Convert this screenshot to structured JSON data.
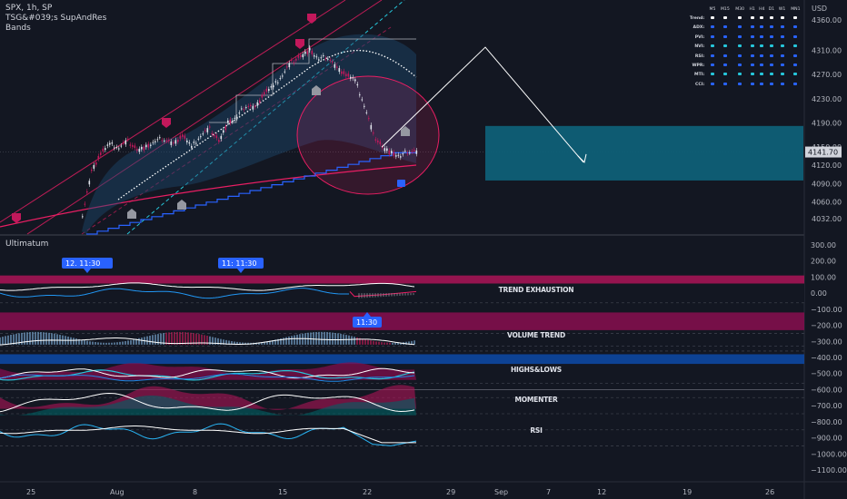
{
  "header": {
    "symbol_line": "SPX, 1h, SP",
    "indicator_line": "TSG&#039;s SupAndRes",
    "indicator_line2": "Bands"
  },
  "indicator_pane": {
    "title": "Ultimatum"
  },
  "price_scale": {
    "currency": "USD",
    "current_price": "4141.70"
  },
  "section_labels": [
    "TREND EXHAUSTION",
    "VOLUME TREND",
    "HIGHS&LOWS",
    "MOMENTER",
    "RSI"
  ],
  "table": {
    "columns": [
      "M5",
      "M15",
      "M30",
      "H1",
      "H4",
      "D1",
      "W1",
      "MN1"
    ],
    "rows": [
      {
        "label": "Trend:",
        "colors": [
          "#ffffff",
          "#ffffff",
          "#ffffff",
          "#ffffff",
          "#ffffff",
          "#ffffff",
          "#ffffff",
          "#ffffff"
        ]
      },
      {
        "label": "ADX:",
        "colors": [
          "#2962ff",
          "#2962ff",
          "#2962ff",
          "#2962ff",
          "#2962ff",
          "#2962ff",
          "#2962ff",
          "#2962ff"
        ]
      },
      {
        "label": "PVI:",
        "colors": [
          "#2962ff",
          "#2962ff",
          "#2962ff",
          "#2962ff",
          "#2962ff",
          "#2962ff",
          "#2962ff",
          "#2962ff"
        ]
      },
      {
        "label": "NVI:",
        "colors": [
          "#26c6da",
          "#26c6da",
          "#26c6da",
          "#26c6da",
          "#26c6da",
          "#26c6da",
          "#26c6da",
          "#26c6da"
        ]
      },
      {
        "label": "RSI:",
        "colors": [
          "#2962ff",
          "#2962ff",
          "#2962ff",
          "#2962ff",
          "#2962ff",
          "#2962ff",
          "#2962ff",
          "#2962ff"
        ]
      },
      {
        "label": "WPR:",
        "colors": [
          "#2962ff",
          "#2962ff",
          "#2962ff",
          "#2962ff",
          "#2962ff",
          "#2962ff",
          "#2962ff",
          "#2962ff"
        ]
      },
      {
        "label": "MTI:",
        "colors": [
          "#26c6da",
          "#26c6da",
          "#26c6da",
          "#26c6da",
          "#26c6da",
          "#26c6da",
          "#26c6da",
          "#26c6da"
        ]
      },
      {
        "label": "CCI:",
        "colors": [
          "#2962ff",
          "#2962ff",
          "#2962ff",
          "#2962ff",
          "#2962ff",
          "#2962ff",
          "#2962ff",
          "#2962ff"
        ]
      }
    ]
  },
  "chart_data": [
    {
      "type": "line",
      "ylim": [
        4010,
        4380
      ],
      "y_ticks": [
        4360,
        4310,
        4270,
        4230,
        4190,
        4150,
        4120,
        4090,
        4060,
        4032
      ],
      "y_tick_labels": [
        "4360.00",
        "4310.00",
        "4270.00",
        "4230.00",
        "4190.00",
        "4150.00",
        "4120.00",
        "4090.00",
        "4060.00",
        "4032.00"
      ],
      "x_tick_labels": [
        "25",
        "Aug",
        "8",
        "15",
        "22",
        "29",
        "Sep",
        "7",
        "12",
        "19",
        "26"
      ],
      "price_path": {
        "x": [
          90,
          100,
          110,
          120,
          130,
          140,
          150,
          160,
          170,
          180,
          190,
          200,
          210,
          220,
          230,
          240,
          250,
          260,
          270,
          280,
          290,
          300,
          310,
          320,
          330,
          340,
          350,
          360,
          370,
          380,
          390,
          400,
          410,
          420,
          430,
          440,
          450,
          458
        ],
        "y": [
          4040,
          4110,
          4140,
          4155,
          4150,
          4160,
          4145,
          4150,
          4160,
          4165,
          4155,
          4170,
          4150,
          4170,
          4180,
          4160,
          4190,
          4200,
          4220,
          4215,
          4240,
          4250,
          4270,
          4290,
          4300,
          4310,
          4295,
          4300,
          4280,
          4270,
          4260,
          4220,
          4170,
          4150,
          4140,
          4135,
          4145,
          4142
        ]
      },
      "target_box": {
        "y_top": 4185,
        "y_bottom": 4095
      },
      "projection": {
        "y": [
          4150,
          4315,
          4125
        ]
      }
    },
    {
      "type": "line",
      "ylim": [
        -1150,
        340
      ],
      "y_ticks": [
        300,
        200,
        100,
        0,
        -100,
        -200,
        -300,
        -400,
        -500,
        -600,
        -700,
        -800,
        -900,
        -1000,
        -1100
      ],
      "y_tick_labels": [
        "300.00",
        "200.00",
        "100.00",
        "0.00",
        "−100.00",
        "−200.00",
        "−300.00",
        "−400.00",
        "−500.00",
        "−600.00",
        "−700.00",
        "−800.00",
        "−900.00",
        "−1000.00",
        "−1100.00"
      ],
      "callouts": [
        "12.  11:30",
        "11:  11:30",
        "11:30"
      ]
    }
  ]
}
